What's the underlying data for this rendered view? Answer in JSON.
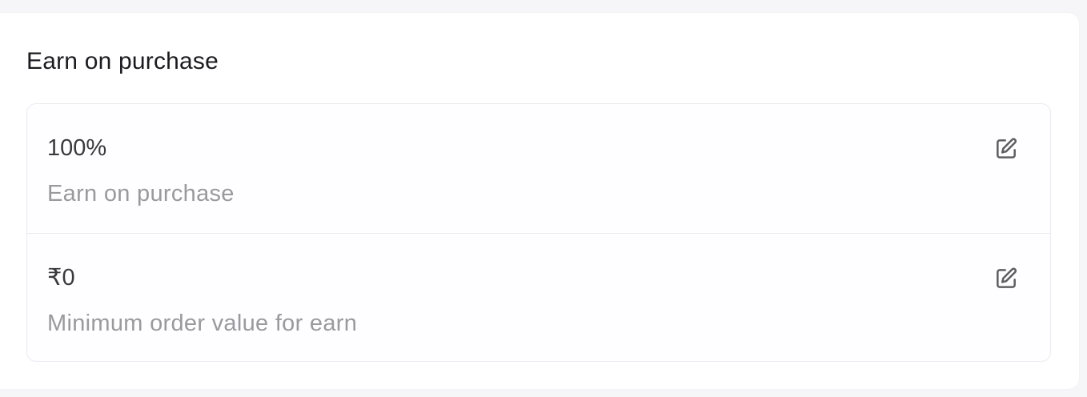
{
  "section": {
    "title": "Earn on purchase"
  },
  "settings": [
    {
      "value": "100%",
      "description": "Earn on purchase",
      "action_icon": "edit-icon"
    },
    {
      "value": "₹0",
      "description": "Minimum order value for earn",
      "action_icon": "edit-icon"
    }
  ],
  "colors": {
    "background": "#f6f5f8",
    "card": "#ffffff",
    "title_text": "#1c1b1f",
    "value_text": "#3a393e",
    "description_text": "#9a999e",
    "border": "#ebeaee",
    "icon": "#5f5e63"
  }
}
